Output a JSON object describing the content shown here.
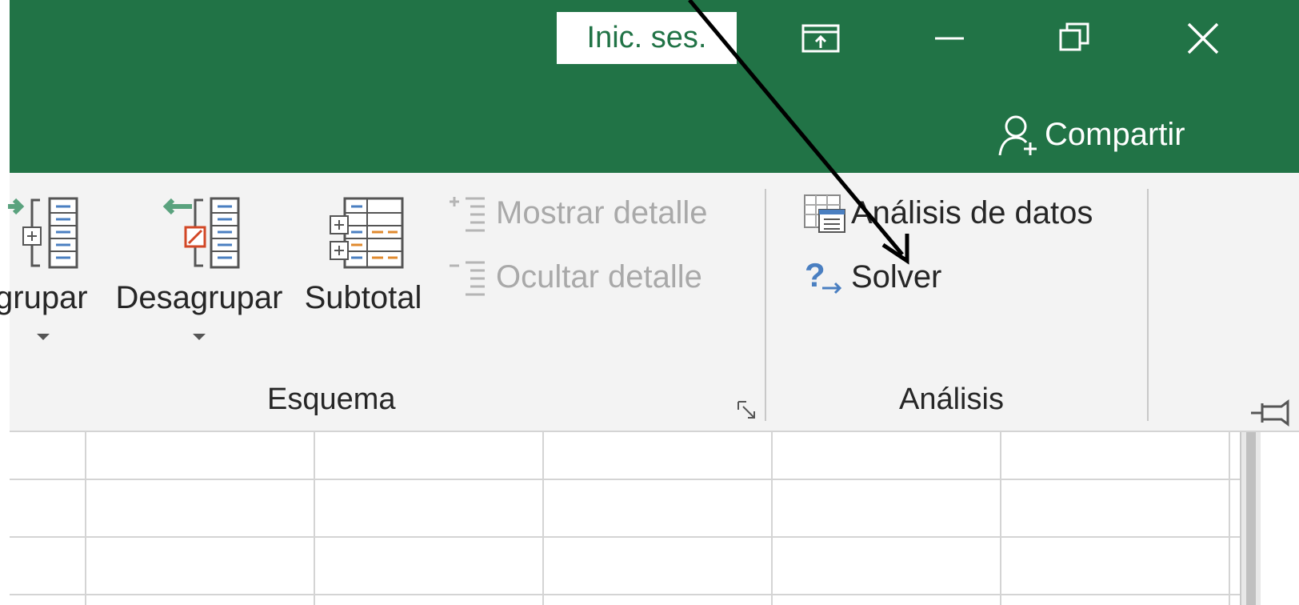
{
  "titlebar": {
    "sign_in_label": "Inic. ses.",
    "share_label": "Compartir",
    "accent_color": "#217346"
  },
  "ribbon": {
    "schema_group": {
      "label": "Esquema",
      "buttons": {
        "group": "grupar",
        "ungroup": "Desagrupar",
        "subtotal": "Subtotal",
        "show_detail": "Mostrar detalle",
        "hide_detail": "Ocultar detalle"
      }
    },
    "analysis_group": {
      "label": "Análisis",
      "buttons": {
        "data_analysis": "Análisis de datos",
        "solver": "Solver"
      }
    }
  },
  "icons": [
    "ribbon-display-options-icon",
    "minimize-icon",
    "restore-icon",
    "close-icon",
    "share-person-icon",
    "group-icon",
    "ungroup-icon",
    "subtotal-icon",
    "show-detail-icon",
    "hide-detail-icon",
    "data-analysis-icon",
    "solver-icon",
    "dialog-launcher-icon",
    "pin-ribbon-icon"
  ]
}
